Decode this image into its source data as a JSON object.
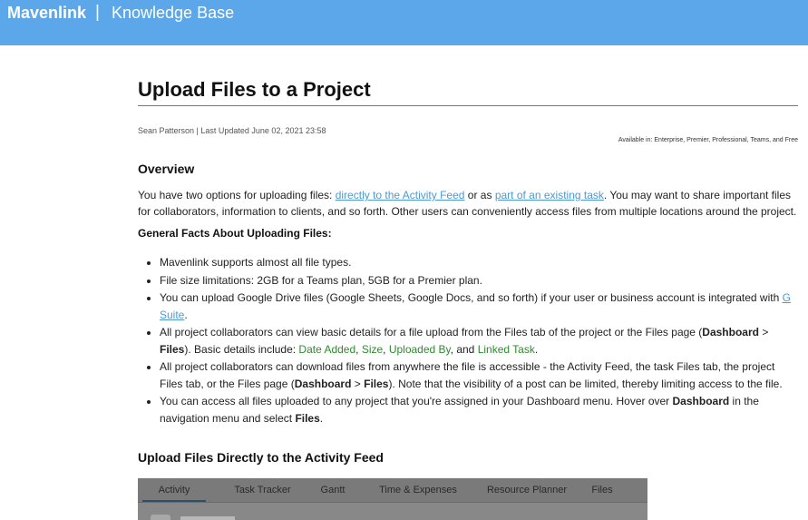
{
  "header": {
    "brand": "Mavenlink",
    "separator": "|",
    "subtitle": "Knowledge Base"
  },
  "article": {
    "title": "Upload Files to a Project",
    "meta": "Sean Patterson | Last Updated June 02, 2021 23:58",
    "availability": "Available in: Enterprise, Premier, Professional, Teams, and Free",
    "overview_heading": "Overview",
    "intro": {
      "t1": "You have two options for uploading files: ",
      "link1": "directly to the Activity Feed",
      "t2": " or as ",
      "link2": "part of an existing task",
      "t3": ". You may want to share important files for collaborators, information to clients, and so forth. Other users can conveniently access files from multiple locations around the project."
    },
    "facts_heading": "General Facts About Uploading Files:",
    "facts": {
      "f1": "Mavenlink supports almost all file types.",
      "f2": "File size limitations: 2GB for a Teams plan, 5GB for a Premier plan.",
      "f3_text": "You can upload Google Drive files (Google Sheets, Google Docs, and so forth) if your user or business account is integrated with ",
      "f3_link": "G Suite",
      "f3_end": ".",
      "f4_a": "All project collaborators can view basic details for a file upload from the Files tab of the project or the Files page (",
      "f4_b": "Dashboard",
      "f4_c": " > ",
      "f4_d": "Files",
      "f4_e": "). Basic details include: ",
      "f4_g1": "Date Added",
      "f4_comma1": ", ",
      "f4_g2": "Size",
      "f4_comma2": ", ",
      "f4_g3": "Uploaded By",
      "f4_and": ", and ",
      "f4_g4": "Linked Task",
      "f4_end": ".",
      "f5_a": "All project collaborators can download files from anywhere the file is accessible - the Activity Feed, the task Files tab, the project Files tab, or the Files page (",
      "f5_b": "Dashboard",
      "f5_c": " > ",
      "f5_d": "Files",
      "f5_e": "). Note that the visibility of a post can be limited, thereby limiting access to the file.",
      "f6_a": "You can access all files uploaded to any project that you're assigned in your Dashboard menu. Hover over ",
      "f6_b": "Dashboard",
      "f6_c": " in the navigation menu and select ",
      "f6_d": "Files",
      "f6_e": "."
    },
    "upload_heading": "Upload Files Directly to the Activity Feed"
  },
  "screenshot_tabs": [
    "Activity",
    "Task Tracker",
    "Gantt",
    "Time & Expenses",
    "Resource Planner",
    "Files"
  ],
  "colors": {
    "header_bg": "#5ba7ea",
    "link": "#4a9ad6",
    "green_text": "#2e8a2e"
  }
}
